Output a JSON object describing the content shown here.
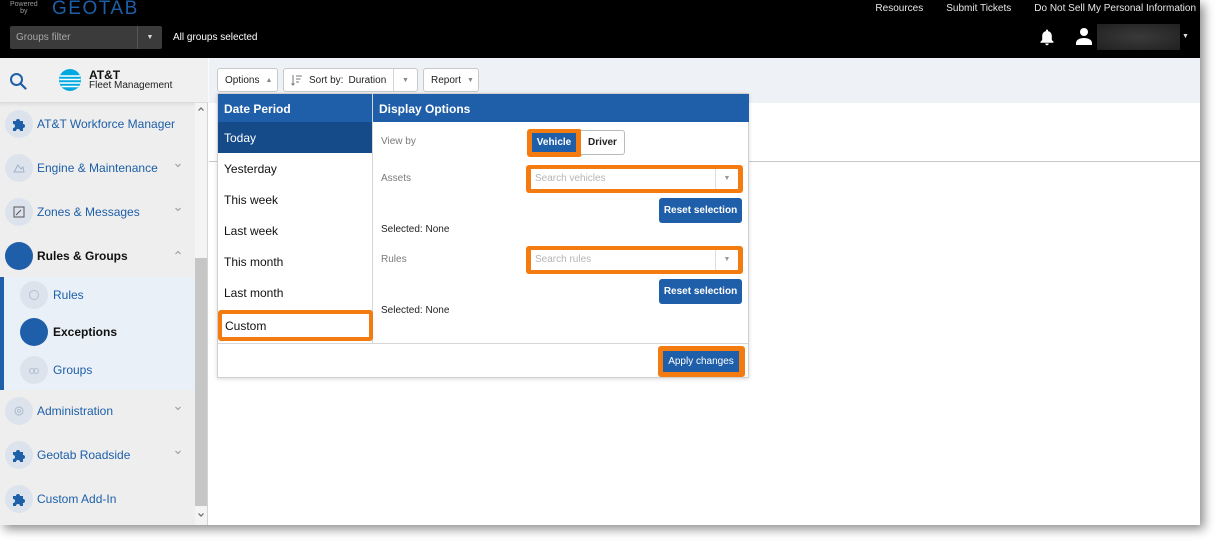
{
  "header": {
    "powered_by": "Powered by",
    "brand": "GEOTAB",
    "groups_filter_placeholder": "Groups filter",
    "groups_status": "All groups selected",
    "links": [
      "Resources",
      "Submit Tickets",
      "Do Not Sell My Personal Information"
    ],
    "icons": {
      "notifications": "bell-icon",
      "user": "user-icon"
    }
  },
  "sidebar": {
    "brand_name": "AT&T",
    "brand_sub": "Fleet Management",
    "items": [
      {
        "label": "AT&T Workforce Manager",
        "icon": "puzzle-icon",
        "expandable": false
      },
      {
        "label": "Engine & Maintenance",
        "icon": "engine-icon",
        "expandable": true
      },
      {
        "label": "Zones & Messages",
        "icon": "zones-icon",
        "expandable": true
      },
      {
        "label": "Rules & Groups",
        "icon": "rules-groups-icon",
        "expandable": true,
        "expanded": true,
        "active": true
      },
      {
        "label": "Administration",
        "icon": "gear-icon",
        "expandable": true
      },
      {
        "label": "Geotab Roadside",
        "icon": "puzzle-icon",
        "expandable": true
      },
      {
        "label": "Custom Add-In",
        "icon": "puzzle-icon",
        "expandable": false
      }
    ],
    "subitems": [
      {
        "label": "Rules",
        "icon": "rules-icon"
      },
      {
        "label": "Exceptions",
        "icon": "exceptions-icon",
        "active": true
      },
      {
        "label": "Groups",
        "icon": "groups-icon"
      }
    ]
  },
  "toolbar": {
    "options_label": "Options",
    "sort_label": "Sort by:",
    "sort_value": "Duration",
    "report_label": "Report"
  },
  "options_panel": {
    "date_period": {
      "title": "Date Period",
      "items": [
        "Today",
        "Yesterday",
        "This week",
        "Last week",
        "This month",
        "Last month",
        "Custom"
      ],
      "selected": "Today",
      "highlighted": "Custom"
    },
    "display_options": {
      "title": "Display Options",
      "view_by_label": "View by",
      "view_by_options": [
        "Vehicle",
        "Driver"
      ],
      "view_by_selected": "Vehicle",
      "assets_label": "Assets",
      "assets_placeholder": "Search vehicles",
      "assets_reset": "Reset selection",
      "assets_selected": "Selected: None",
      "rules_label": "Rules",
      "rules_placeholder": "Search rules",
      "rules_reset": "Reset selection",
      "rules_selected": "Selected: None"
    },
    "apply_label": "Apply changes"
  },
  "colors": {
    "primary": "#1f5fa9",
    "highlight": "#f47b10",
    "header_bg": "#000000"
  }
}
